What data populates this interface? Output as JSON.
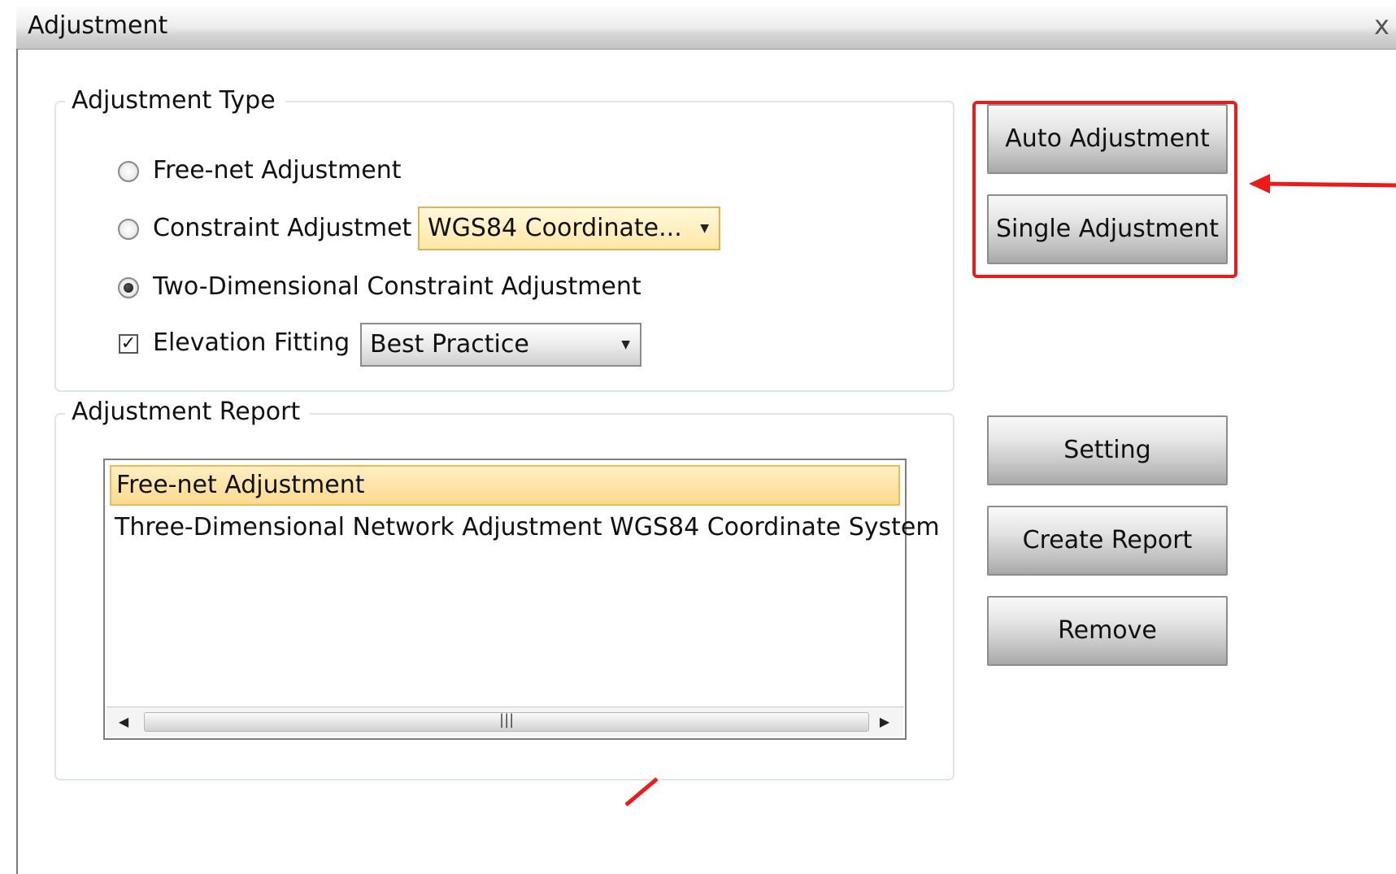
{
  "window": {
    "title": "Adjustment",
    "close_glyph": "x"
  },
  "adjustment_type": {
    "legend": "Adjustment Type",
    "options": {
      "free_net": {
        "label": "Free-net Adjustment",
        "selected": false
      },
      "constraint": {
        "label": "Constraint Adjustmet",
        "selected": false,
        "combo_value": "WGS84 Coordinate..."
      },
      "two_dim": {
        "label": "Two-Dimensional Constraint Adjustment",
        "selected": true
      }
    },
    "elevation": {
      "label": "Elevation Fitting",
      "checked": true,
      "check_glyph": "✓",
      "combo_value": "Best Practice"
    }
  },
  "adjustment_report": {
    "legend": "Adjustment Report",
    "items": [
      {
        "label": "Free-net Adjustment",
        "selected": true
      },
      {
        "label": "Three-Dimensional Network Adjustment WGS84 Coordinate System",
        "selected": false
      }
    ],
    "scroll_grip": "|||"
  },
  "buttons": {
    "auto": "Auto Adjustment",
    "single": "Single Adjustment",
    "setting": "Setting",
    "create_report": "Create Report",
    "remove": "Remove"
  },
  "icons": {
    "combo_arrow": "dropdown-arrow-icon",
    "scroll_left": "scroll-left-icon",
    "scroll_right": "scroll-right-icon",
    "close": "close-icon"
  },
  "colors": {
    "highlight_border": "#e0b255",
    "selection_fill": "#fcd98e",
    "annotation_red": "#ee1a1a"
  }
}
